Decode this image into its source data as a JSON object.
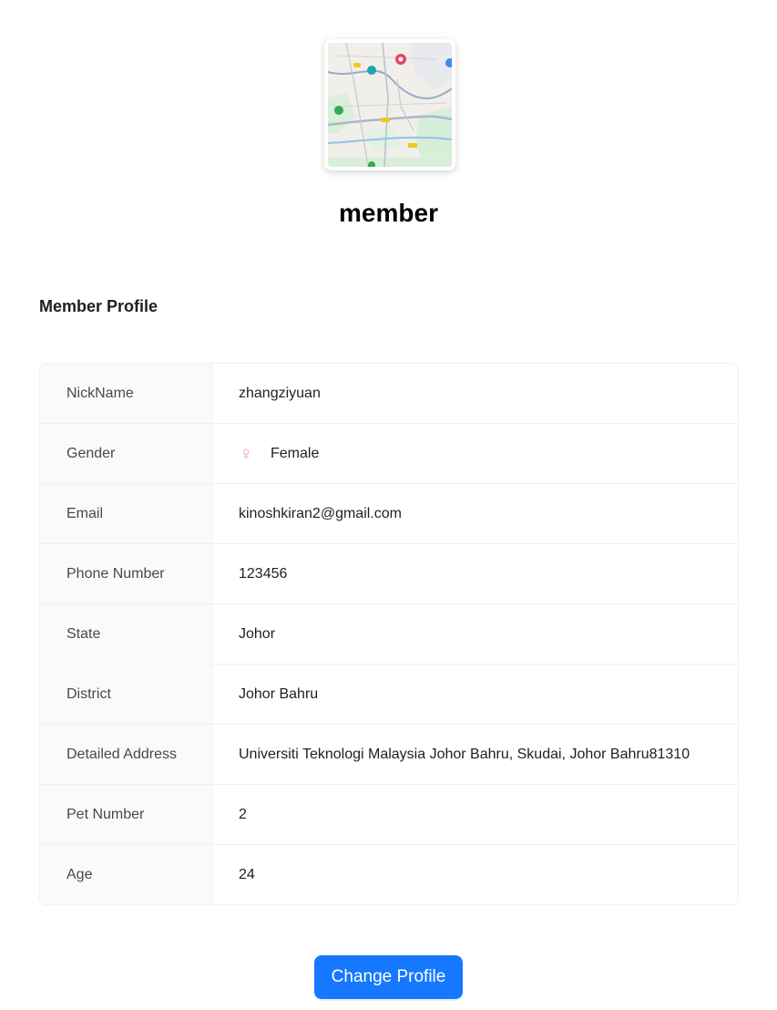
{
  "header": {
    "avatar_alt": "map thumbnail",
    "role_title": "member"
  },
  "section": {
    "title": "Member Profile"
  },
  "profile_rows": [
    {
      "label": "NickName",
      "value": "zhangziyuan"
    },
    {
      "label": "Gender",
      "value": "Female",
      "icon": "female-icon"
    },
    {
      "label": "Email",
      "value": "kinoshkiran2@gmail.com"
    },
    {
      "label": "Phone Number",
      "value": "123456"
    },
    {
      "label": "State",
      "value": "Johor"
    },
    {
      "label": "District",
      "value": "Johor Bahru"
    },
    {
      "label": "Detailed Address",
      "value": "Universiti Teknologi Malaysia Johor Bahru, Skudai, Johor Bahru81310"
    },
    {
      "label": "Pet Number",
      "value": "2"
    },
    {
      "label": "Age",
      "value": "24"
    }
  ],
  "actions": {
    "change_profile_label": "Change Profile"
  },
  "colors": {
    "primary": "#1677ff",
    "female_icon": "#f2a3bf",
    "label_bg": "#fafafa",
    "border": "#f0f0f0"
  }
}
